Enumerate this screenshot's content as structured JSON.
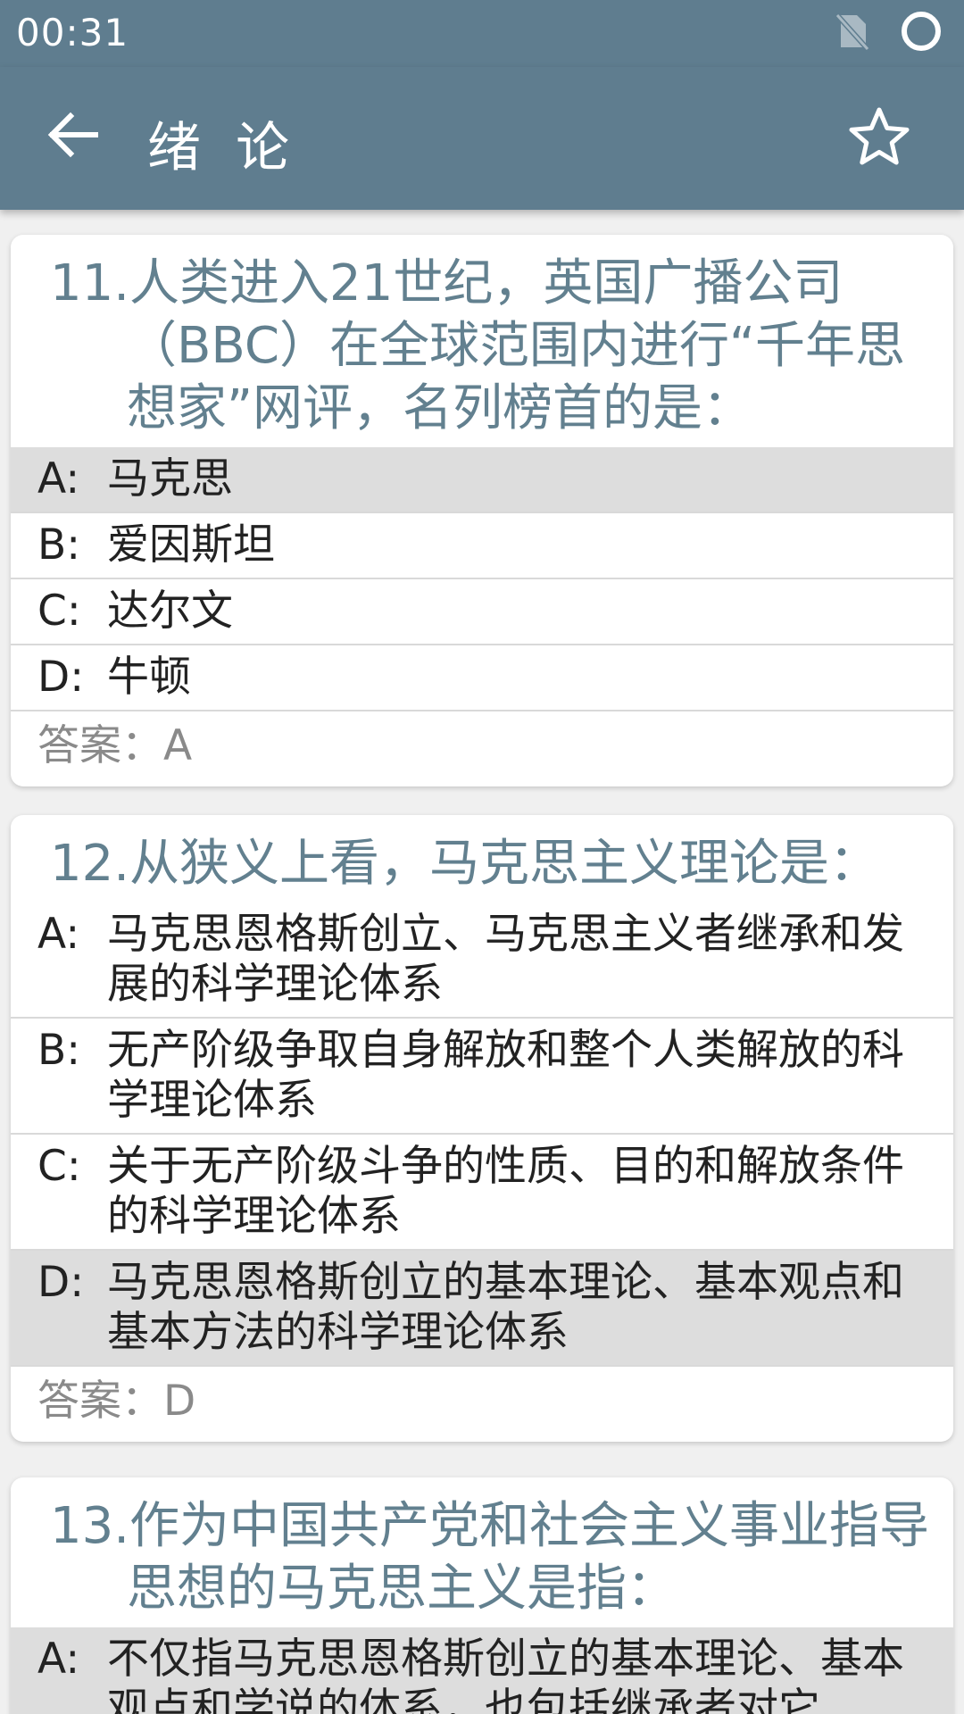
{
  "status_bar": {
    "time": "00:31",
    "icons": [
      "no-sim-icon",
      "circle-status-icon"
    ]
  },
  "app_bar": {
    "title": "绪 论",
    "back_icon": "arrow-left-icon",
    "favorite_icon": "star-outline-icon"
  },
  "colors": {
    "primary": "#5f7d8f",
    "question_text": "#62808f",
    "selected_option_bg": "#dddddd"
  },
  "questions": [
    {
      "text": "11.人类进入21世纪，英国广播公司（BBC）在全球范围内进行“千年思想家”网评，名列榜首的是：",
      "options": [
        {
          "letter": "A:",
          "text": "马克思",
          "selected": true
        },
        {
          "letter": "B:",
          "text": "爱因斯坦",
          "selected": false
        },
        {
          "letter": "C:",
          "text": "达尔文",
          "selected": false
        },
        {
          "letter": "D:",
          "text": "牛顿",
          "selected": false
        }
      ],
      "answer": "答案：A"
    },
    {
      "text": "12.从狭义上看，马克思主义理论是：",
      "options": [
        {
          "letter": "A:",
          "text": "马克思恩格斯创立、马克思主义者继承和发展的科学理论体系",
          "selected": false
        },
        {
          "letter": "B:",
          "text": "无产阶级争取自身解放和整个人类解放的科学理论体系",
          "selected": false
        },
        {
          "letter": "C:",
          "text": "关于无产阶级斗争的性质、目的和解放条件的科学理论体系",
          "selected": false
        },
        {
          "letter": "D:",
          "text": "马克思恩格斯创立的基本理论、基本观点和基本方法的科学理论体系",
          "selected": true
        }
      ],
      "answer": "答案：D"
    },
    {
      "text": "13.作为中国共产党和社会主义事业指导思想的马克思主义是指：",
      "options": [
        {
          "letter": "A:",
          "text": "不仅指马克思恩格斯创立的基本理论、基本观点和学说的体系，也包括继承者对它",
          "selected": true
        }
      ]
    }
  ]
}
